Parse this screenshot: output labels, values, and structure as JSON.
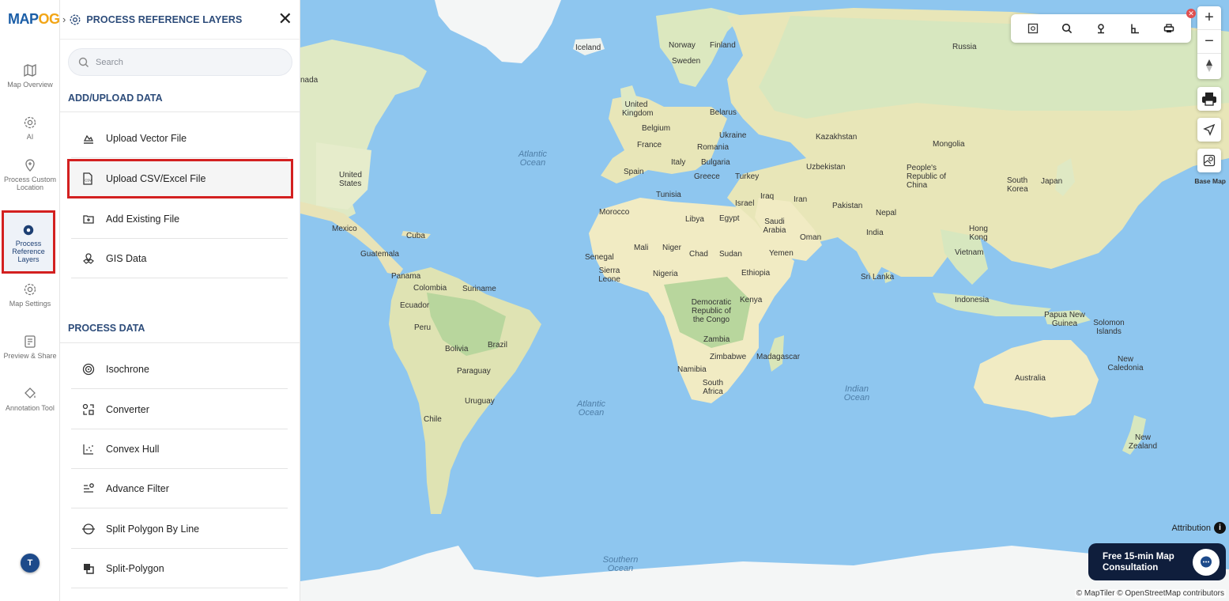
{
  "app": {
    "logo_text": "MAP",
    "logo_accent": "OG"
  },
  "rail": [
    {
      "label": "Map Overview"
    },
    {
      "label": "AI"
    },
    {
      "label": "Process Custom Location"
    },
    {
      "label": "Process Reference Layers"
    },
    {
      "label": "Map Settings"
    },
    {
      "label": "Preview & Share"
    },
    {
      "label": "Annotation Tool"
    }
  ],
  "user": {
    "initial": "T"
  },
  "panel": {
    "title": "PROCESS REFERENCE LAYERS",
    "search_placeholder": "Search",
    "add_section": "ADD/UPLOAD DATA",
    "add_items": [
      "Upload Vector File",
      "Upload CSV/Excel File",
      "Add Existing File",
      "GIS Data"
    ],
    "process_section": "PROCESS DATA",
    "process_items": [
      "Isochrone",
      "Converter",
      "Convex Hull",
      "Advance Filter",
      "Split Polygon By Line",
      "Split-Polygon"
    ]
  },
  "map": {
    "labels": {
      "iceland": "Iceland",
      "norway": "Norway",
      "finland": "Finland",
      "sweden": "Sweden",
      "russia": "Russia",
      "uk": "United Kingdom",
      "belarus": "Belarus",
      "belgium": "Belgium",
      "ukraine": "Ukraine",
      "france": "France",
      "romania": "Romania",
      "kazakhstan": "Kazakhstan",
      "mongolia": "Mongolia",
      "italy": "Italy",
      "bulgaria": "Bulgaria",
      "uzbekistan": "Uzbekistan",
      "spain": "Spain",
      "greece": "Greece",
      "turkey": "Turkey",
      "prc": "People's Republic of China",
      "southkorea": "South Korea",
      "japan": "Japan",
      "tunisia": "Tunisia",
      "iraq": "Iraq",
      "iran": "Iran",
      "israel": "Israel",
      "pakistan": "Pakistan",
      "morocco": "Morocco",
      "libya": "Libya",
      "egypt": "Egypt",
      "saudi": "Saudi Arabia",
      "nepal": "Nepal",
      "india": "India",
      "hongkong": "Hong Kong",
      "oman": "Oman",
      "mali": "Mali",
      "niger": "Niger",
      "chad": "Chad",
      "sudan": "Sudan",
      "yemen": "Yemen",
      "vietnam": "Vietnam",
      "senegal": "Senegal",
      "sierra": "Sierra Leone",
      "nigeria": "Nigeria",
      "ethiopia": "Ethiopia",
      "srilanka": "Sri Lanka",
      "drc": "Democratic Republic of the Congo",
      "kenya": "Kenya",
      "indonesia": "Indonesia",
      "png": "Papua New Guinea",
      "solomon": "Solomon Islands",
      "zambia": "Zambia",
      "zimbabwe": "Zimbabwe",
      "madagascar": "Madagascar",
      "newcaledonia": "New Caledonia",
      "namibia": "Namibia",
      "southafrica": "South Africa",
      "australia": "Australia",
      "newzealand": "New Zealand",
      "usa": "United States",
      "canada": "nada",
      "mexico": "Mexico",
      "cuba": "Cuba",
      "guatemala": "Guatemala",
      "panama": "Panama",
      "colombia": "Colombia",
      "suriname": "Suriname",
      "ecuador": "Ecuador",
      "peru": "Peru",
      "brazil": "Brazil",
      "bolivia": "Bolivia",
      "paraguay": "Paraguay",
      "uruguay": "Uruguay",
      "chile": "Chile",
      "atlantic_n": "Atlantic Ocean",
      "atlantic_s": "Atlantic Ocean",
      "indian": "Indian Ocean",
      "southern": "Southern Ocean"
    }
  },
  "controls": {
    "basemap_label": "Base Map",
    "attribution": "Attribution",
    "info": "i"
  },
  "consult": {
    "line1": "Free 15-min Map",
    "line2": "Consultation"
  },
  "copyright": "© MapTiler © OpenStreetMap contributors"
}
